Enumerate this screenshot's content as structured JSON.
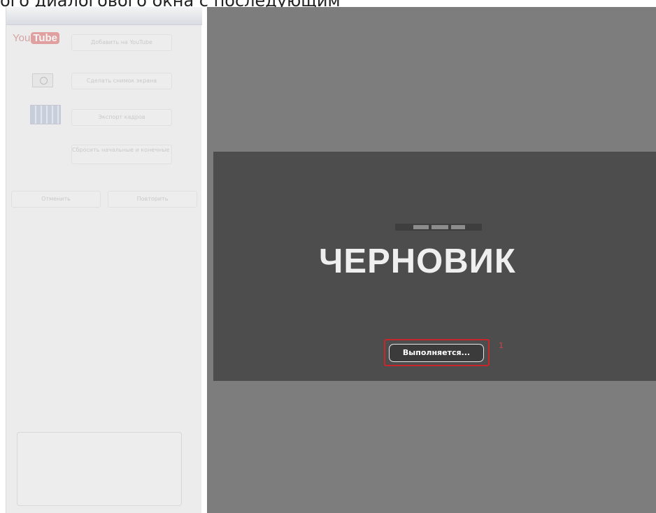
{
  "header": {
    "top_text": "ого диалогового окна с последующим"
  },
  "sidebar": {
    "youtube_logo": {
      "you": "You",
      "tube": "Tube"
    },
    "buttons": {
      "upload_youtube": "Добавить на YouTube",
      "screenshot": "Сделать снимок экрана",
      "export_frames": "Экспорт кадров",
      "reset_points": "Сбросить начальные и конечные точки",
      "cancel": "Отменить",
      "repeat": "Повторить"
    },
    "icons": [
      "youtube-logo-icon",
      "camera-icon",
      "film-frames-icon"
    ]
  },
  "preview": {
    "watermark": "ЧЕРНОВИК",
    "progress_label": "Выполняется...",
    "callout_number": "1",
    "colors": {
      "highlight_border": "#c7262b",
      "canvas_bg": "#7d7d7d",
      "video_bg": "#4d4d4d"
    }
  }
}
